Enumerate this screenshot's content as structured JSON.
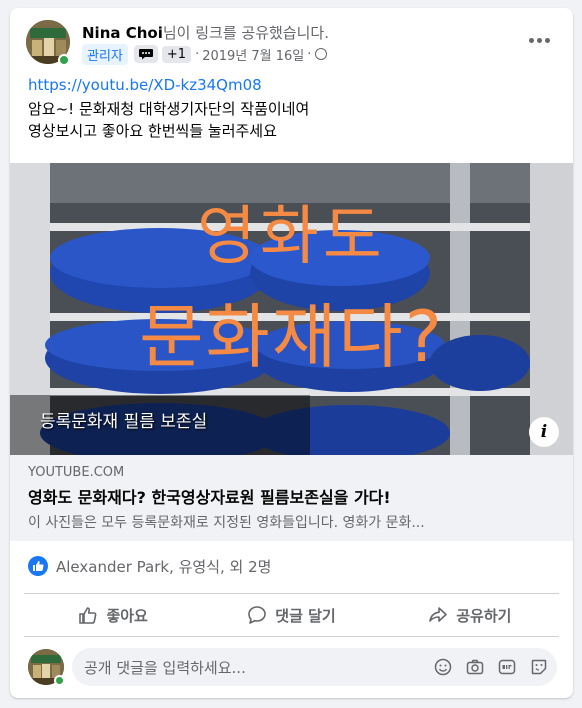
{
  "post": {
    "author_name": "Nina Choi",
    "author_action": "님이 링크를 공유했습니다.",
    "role_badge": "관리자",
    "extra_count": "+1",
    "date": "2019년 7월 16일",
    "separator": "·",
    "link_url": "https://youtu.be/XD-kz34Qm08",
    "text_line1": "암요~! 문화재청 대학생기자단의 작품이네여",
    "text_line2": "영상보시고 좋아요 한번씩들 눌러주세요"
  },
  "preview": {
    "overlay_line1": "영화도",
    "overlay_line2": "문화재다?",
    "caption": "등록문화재 필름 보존실",
    "info_label": "i"
  },
  "link": {
    "domain": "YOUTUBE.COM",
    "title": "영화도 문화재다? 한국영상자료원 필름보존실을 가다!",
    "description": "이 사진들은 모두 등록문화재로 지정된 영화들입니다. 영화가 문화..."
  },
  "reactions": {
    "text": "Alexander Park, 유영식, 외 2명"
  },
  "actions": {
    "like": "좋아요",
    "comment": "댓글 달기",
    "share": "공유하기"
  },
  "comment": {
    "placeholder": "공개 댓글을 입력하세요..."
  },
  "colors": {
    "accent": "#1877f2",
    "online": "#31a24c",
    "overlay_text": "#f58a45"
  }
}
